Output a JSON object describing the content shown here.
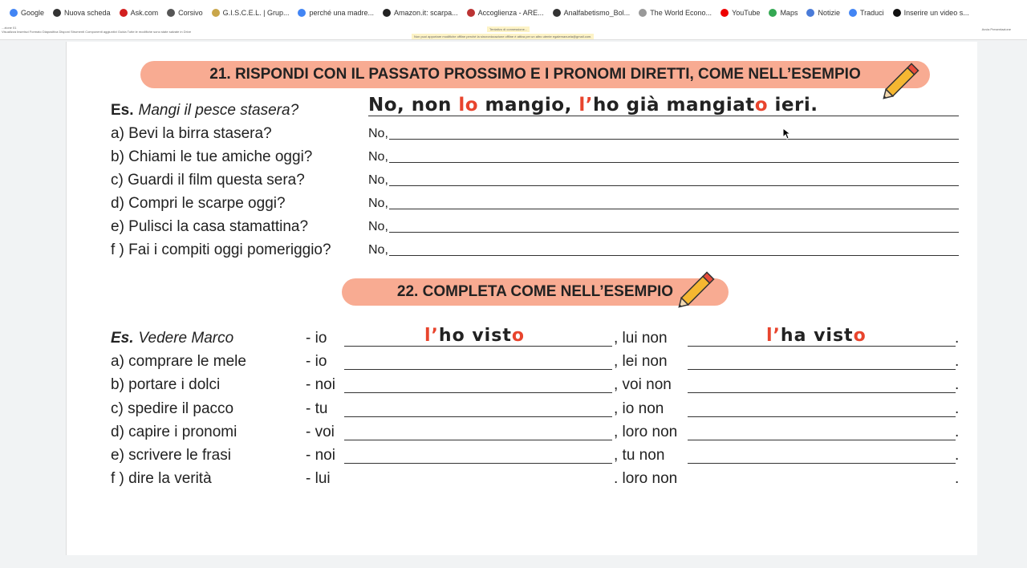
{
  "bookmarks": [
    {
      "label": "Google",
      "icon": "google-icon",
      "color": "#4285f4"
    },
    {
      "label": "Nuova scheda",
      "icon": "globe-icon",
      "color": "#333"
    },
    {
      "label": "Ask.com",
      "icon": "ask-icon",
      "color": "#d21f1f"
    },
    {
      "label": "Corsivo",
      "icon": "corsivo-icon",
      "color": "#555"
    },
    {
      "label": "G.I.S.C.E.L. | Grup...",
      "icon": "giscel-icon",
      "color": "#c9a64a"
    },
    {
      "label": "perché una madre...",
      "icon": "google-icon",
      "color": "#4285f4"
    },
    {
      "label": "Amazon.it: scarpa...",
      "icon": "amazon-icon",
      "color": "#222"
    },
    {
      "label": "Accoglienza - ARE...",
      "icon": "are-icon",
      "color": "#b33"
    },
    {
      "label": "Analfabetismo_Bol...",
      "icon": "globe-icon",
      "color": "#333"
    },
    {
      "label": "The World Econo...",
      "icon": "wef-icon",
      "color": "#999"
    },
    {
      "label": "YouTube",
      "icon": "youtube-icon",
      "color": "#e00"
    },
    {
      "label": "Maps",
      "icon": "maps-icon",
      "color": "#34a853"
    },
    {
      "label": "Notizie",
      "icon": "news-icon",
      "color": "#4a7bd8"
    },
    {
      "label": "Traduci",
      "icon": "translate-icon",
      "color": "#4285f4"
    },
    {
      "label": "Inserire un video s...",
      "icon": "inserire-icon",
      "color": "#111"
    }
  ],
  "toolbar": {
    "title": "...zione 01",
    "menu": "Visualizza  Inserisci  Formato  Diapositiva  Disponi  Strumenti  Componenti aggiuntivi  Guida   Tutte le modifiche sono state salvate in Drive",
    "notice_connecting": "Tentativo di connessione...",
    "notice_offline": "Non puoi apportare modifiche offline perché la sincronizzazione offline è attiva per un altro utente egalemanuela@gmail.com.",
    "present": "Avvia Presentazione"
  },
  "ex21": {
    "title": "21. RISPONDI CON IL PASSATO PROSSIMO E I PRONOMI DIRETTI, COME NELL’ESEMPIO",
    "example": {
      "prefix": "Es.",
      "question": "Mangi il pesce stasera?",
      "answer_parts": [
        {
          "t": "No, non ",
          "red": false
        },
        {
          "t": "lo",
          "red": true
        },
        {
          "t": " mangio, ",
          "red": false
        },
        {
          "t": "l’",
          "red": true
        },
        {
          "t": "ho già mangiat",
          "red": false
        },
        {
          "t": "o",
          "red": true
        },
        {
          "t": " ieri.",
          "red": false
        }
      ]
    },
    "answer_prefix": "No,",
    "questions": [
      "a) Bevi la birra stasera?",
      "b) Chiami le tue amiche oggi?",
      "c) Guardi il film questa sera?",
      "d) Compri le scarpe oggi?",
      "e) Pulisci la casa stamattina?",
      "f ) Fai i compiti oggi pomeriggio?"
    ]
  },
  "ex22": {
    "title": "22. COMPLETA COME NELL’ESEMPIO",
    "example": {
      "prefix": "Es.",
      "verb": "Vedere Marco",
      "pron": "-  io",
      "ans1": [
        {
          "t": "l’",
          "red": true
        },
        {
          "t": "ho vist",
          "red": false
        },
        {
          "t": "o",
          "red": true
        }
      ],
      "neg": ", lui  non",
      "ans2": [
        {
          "t": "l’",
          "red": true
        },
        {
          "t": "ha vist",
          "red": false
        },
        {
          "t": "o",
          "red": true
        }
      ]
    },
    "rows": [
      {
        "verb": "a) comprare le mele",
        "pron": "-  io",
        "neg": ", lei  non"
      },
      {
        "verb": "b) portare i dolci",
        "pron": "- noi",
        "neg": ", voi  non"
      },
      {
        "verb": "c) spedire il pacco",
        "pron": "-  tu",
        "neg": ", io   non"
      },
      {
        "verb": "d) capire i pronomi",
        "pron": "- voi",
        "neg": ", loro non"
      },
      {
        "verb": "e) scrivere le frasi",
        "pron": "- noi",
        "neg": ", tu   non"
      },
      {
        "verb": "f ) dire la verità",
        "pron": "-  lui",
        "neg": ". loro non"
      }
    ],
    "end": "."
  },
  "colors": {
    "banner": "#f8ab92",
    "handwriting_red": "#e8442d"
  }
}
